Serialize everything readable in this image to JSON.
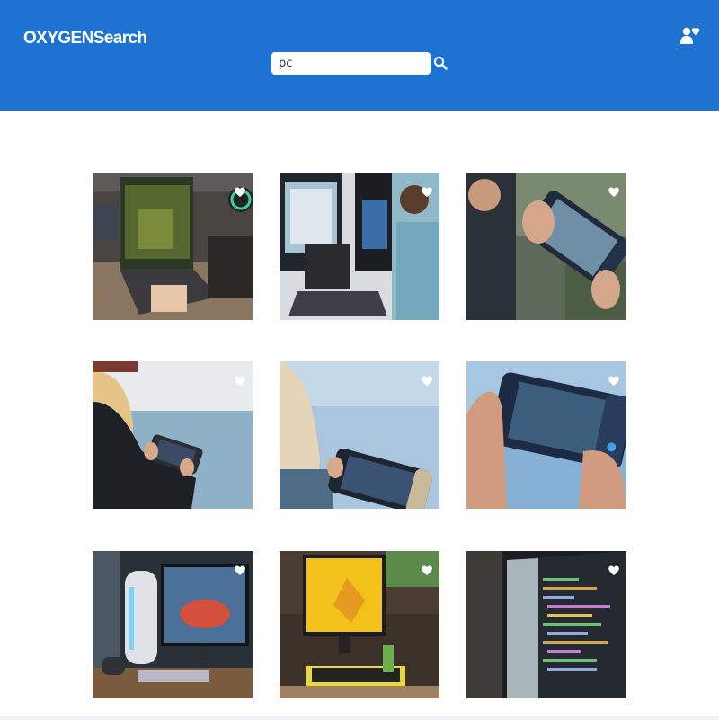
{
  "header": {
    "brand": "OXYGENSearch",
    "search": {
      "value": "pc"
    }
  },
  "colors": {
    "header_bg": "#1e73d2",
    "heart": "#ffffff"
  },
  "icons": {
    "search": "magnifier-icon",
    "user": "users-heart-icon",
    "favorite": "heart-icon"
  },
  "results": [
    {
      "subject": "gaming-laptop-photo"
    },
    {
      "subject": "man-at-computer-desk-photo"
    },
    {
      "subject": "handheld-console-photo"
    },
    {
      "subject": "woman-holding-console-photo"
    },
    {
      "subject": "console-blurred-photo"
    },
    {
      "subject": "hands-holding-console-photo"
    },
    {
      "subject": "gaming-desktop-setup-photo"
    },
    {
      "subject": "yellow-monitor-desk-photo"
    },
    {
      "subject": "code-screen-photo"
    }
  ]
}
